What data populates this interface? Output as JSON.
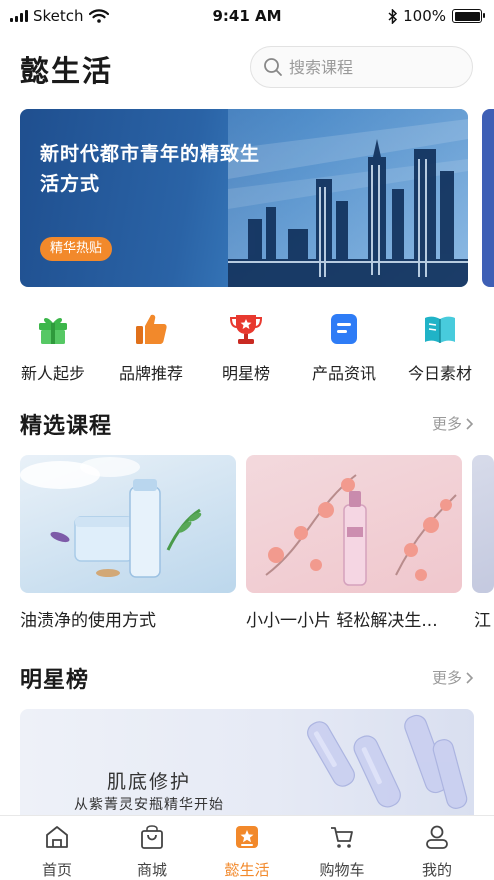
{
  "status_bar": {
    "carrier": "Sketch",
    "time": "9:41 AM",
    "battery": "100%"
  },
  "header": {
    "title": "懿生活",
    "search_placeholder": "搜索课程"
  },
  "banner": {
    "title": "新时代都市青年的精致生活方式",
    "tag": "精华热贴"
  },
  "categories": [
    {
      "label": "新人起步",
      "icon": "gift-icon",
      "color": "#3cb64a"
    },
    {
      "label": "品牌推荐",
      "icon": "thumbs-up-icon",
      "color": "#f2892b"
    },
    {
      "label": "明星榜",
      "icon": "trophy-icon",
      "color": "#e8392f"
    },
    {
      "label": "产品资讯",
      "icon": "document-icon",
      "color": "#2e7cf6"
    },
    {
      "label": "今日素材",
      "icon": "book-icon",
      "color": "#20b3c7"
    }
  ],
  "featured": {
    "title": "精选课程",
    "more": "更多",
    "courses": [
      {
        "caption": "油渍净的使用方式"
      },
      {
        "caption": "小小一小片 轻松解决生..."
      },
      {
        "caption": "江"
      }
    ]
  },
  "stars": {
    "title": "明星榜",
    "more": "更多",
    "banner_title": "肌底修护",
    "banner_subtitle": "从紫菁灵安瓶精华开始"
  },
  "tabbar": {
    "items": [
      {
        "label": "首页",
        "icon": "home-icon"
      },
      {
        "label": "商城",
        "icon": "shopping-bag-icon"
      },
      {
        "label": "懿生活",
        "icon": "star-badge-icon",
        "active": true
      },
      {
        "label": "购物车",
        "icon": "cart-icon"
      },
      {
        "label": "我的",
        "icon": "user-icon"
      }
    ]
  },
  "colors": {
    "accent": "#f2892b",
    "text": "#222222",
    "muted": "#9a9a9a"
  }
}
